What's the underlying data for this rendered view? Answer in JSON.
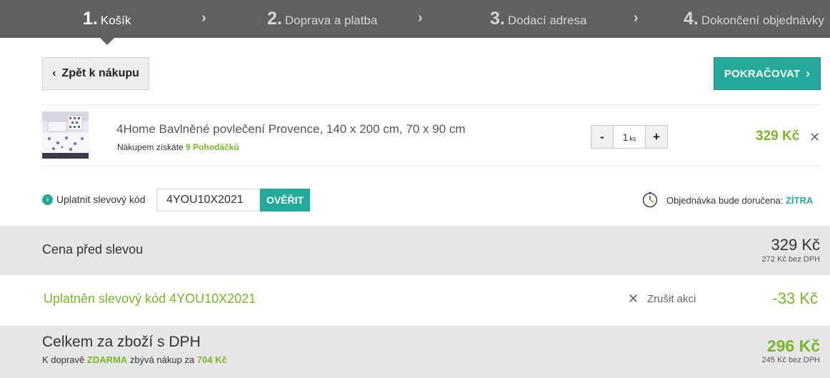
{
  "steps": [
    {
      "num": "1.",
      "label": "Košík",
      "active": true
    },
    {
      "num": "2.",
      "label": "Doprava a platba",
      "active": false
    },
    {
      "num": "3.",
      "label": "Dodací adresa",
      "active": false
    },
    {
      "num": "4.",
      "label": "Dokončení objednávky",
      "active": false
    }
  ],
  "step_arrow": "›",
  "buttons": {
    "back_label": "Zpět k nákupu",
    "continue_label": "POKRAČOVAT"
  },
  "product": {
    "name": "4Home Bavlněné povlečení Provence, 140 x 200 cm, 70 x 90 cm",
    "points_prefix": "Nákupem získáte ",
    "points_value": "9 Pohodáčků",
    "qty_minus": "-",
    "qty_value": "1",
    "qty_unit": "ks",
    "qty_plus": "+",
    "price": "329 Kč",
    "remove": "✕"
  },
  "discount": {
    "label": "Uplatnit slevový kód",
    "code_value": "4YOU10X2021",
    "verify_label": "OVĚŘIT"
  },
  "delivery": {
    "prefix": "Objednávka bude doručena: ",
    "when": "ZÍTRA"
  },
  "summary": {
    "before_label": "Cena před slevou",
    "before_price": "329 Kč",
    "before_vat": "272 Kč bez DPH",
    "applied_label": "Uplatněn slevový kód 4YOU10X2021",
    "cancel_label": "Zrušit akci",
    "discount_amount": "-33 Kč",
    "total_label": "Celkem za zboží s DPH",
    "free_prefix": "K dopravě ",
    "free_word": "ZDARMA",
    "free_middle": " zbývá nákup za ",
    "free_amount": "704 Kč",
    "total_price": "296 Kč",
    "total_vat": "245 Kč bez DPH"
  },
  "colors": {
    "accent_teal": "#26a89a",
    "accent_green": "#7ab42b",
    "steps_bg": "#606060"
  }
}
